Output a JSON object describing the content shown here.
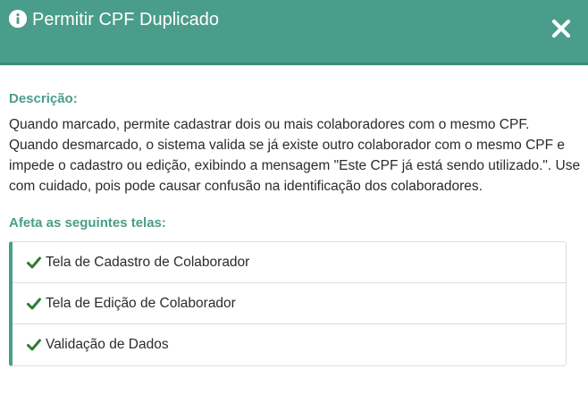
{
  "header": {
    "title": "Permitir CPF Duplicado",
    "icon": "info-circle-icon",
    "close_icon": "close-icon",
    "background_color": "#4a9d8a"
  },
  "body": {
    "description_label": "Descrição:",
    "description_text": "Quando marcado, permite cadastrar dois ou mais colaboradores com o mesmo CPF. Quando desmarcado, o sistema valida se já existe outro colaborador com o mesmo CPF e impede o cadastro ou edição, exibindo a mensagem \"Este CPF já está sendo utilizado.\". Use com cuidado, pois pode causar confusão na identificação dos colaboradores.",
    "affects_label": "Afeta as seguintes telas:",
    "screens": [
      {
        "label": "Tela de Cadastro de Colaborador",
        "icon": "check-icon"
      },
      {
        "label": "Tela de Edição de Colaborador",
        "icon": "check-icon"
      },
      {
        "label": "Validação de Dados",
        "icon": "check-icon"
      }
    ],
    "accent_color": "#4a9d8a",
    "check_color": "#2e7d32"
  }
}
